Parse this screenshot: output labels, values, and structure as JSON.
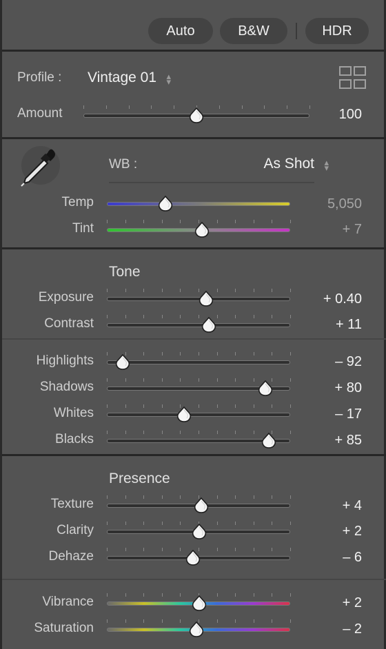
{
  "treatment": {
    "auto": "Auto",
    "bw": "B&W",
    "hdr": "HDR"
  },
  "profile": {
    "label": "Profile :",
    "value": "Vintage 01",
    "browse_icon": "grid-icon"
  },
  "amount": {
    "label": "Amount",
    "value": "100",
    "fraction": 0.5
  },
  "wb": {
    "label": "WB :",
    "value": "As Shot",
    "picker_icon": "eyedropper-icon",
    "temp": {
      "label": "Temp",
      "value": "5,050",
      "fraction": 0.32
    },
    "tint": {
      "label": "Tint",
      "value": "+ 7",
      "fraction": 0.52
    }
  },
  "tone": {
    "title": "Tone",
    "exposure": {
      "label": "Exposure",
      "value": "+ 0.40",
      "fraction": 0.54
    },
    "contrast": {
      "label": "Contrast",
      "value": "+ 11",
      "fraction": 0.555
    },
    "highlights": {
      "label": "Highlights",
      "value": "– 92",
      "fraction": 0.085
    },
    "shadows": {
      "label": "Shadows",
      "value": "+ 80",
      "fraction": 0.865
    },
    "whites": {
      "label": "Whites",
      "value": "– 17",
      "fraction": 0.42
    },
    "blacks": {
      "label": "Blacks",
      "value": "+ 85",
      "fraction": 0.885
    }
  },
  "presence": {
    "title": "Presence",
    "texture": {
      "label": "Texture",
      "value": "+ 4",
      "fraction": 0.515
    },
    "clarity": {
      "label": "Clarity",
      "value": "+ 2",
      "fraction": 0.505
    },
    "dehaze": {
      "label": "Dehaze",
      "value": "– 6",
      "fraction": 0.47
    },
    "vibrance": {
      "label": "Vibrance",
      "value": "+ 2",
      "fraction": 0.505
    },
    "saturation": {
      "label": "Saturation",
      "value": "– 2",
      "fraction": 0.49
    }
  },
  "colors": {
    "panel": "#535353",
    "temp_gradient": [
      "#3a3ad0",
      "#7a7a7a",
      "#d8cd2a"
    ],
    "tint_gradient": [
      "#2fc42f",
      "#8a8a8a",
      "#c535c5"
    ],
    "vibrance_gradient": [
      "#6a6a6a",
      "#c9c027",
      "#2ac7a0",
      "#3a6bd8",
      "#9a3ad0",
      "#d8334a"
    ]
  }
}
